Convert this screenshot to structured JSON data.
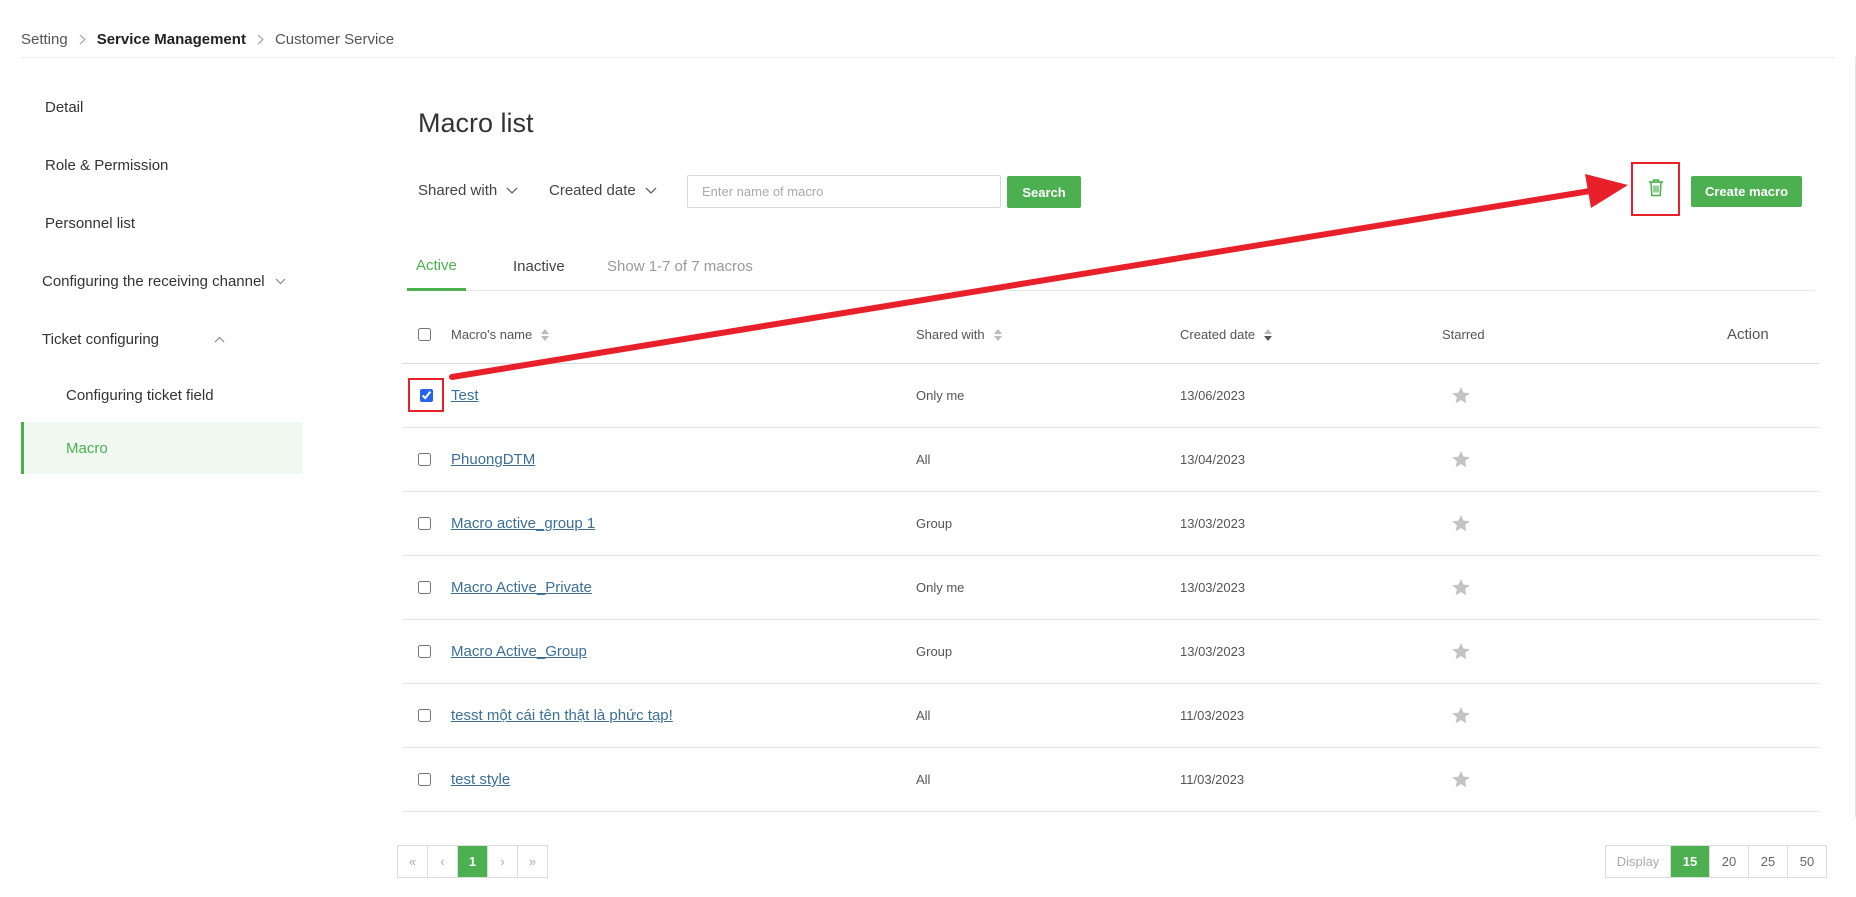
{
  "breadcrumb": {
    "items": [
      "Setting",
      "Service Management",
      "Customer Service"
    ]
  },
  "sidebar": {
    "items": [
      {
        "label": "Detail"
      },
      {
        "label": "Role & Permission"
      },
      {
        "label": "Personnel list"
      },
      {
        "label": "Configuring the receiving channel"
      },
      {
        "label": "Ticket configuring"
      },
      {
        "label": "Configuring ticket field"
      },
      {
        "label": "Macro"
      }
    ]
  },
  "main": {
    "title": "Macro list",
    "filters": {
      "shared_with": "Shared with",
      "created_date": "Created date"
    },
    "search": {
      "placeholder": "Enter name of macro",
      "value": "",
      "button_label": "Search"
    },
    "create_label": "Create macro",
    "delete_icon": "trash-icon",
    "tabs": [
      {
        "label": "Active"
      },
      {
        "label": "Inactive"
      }
    ],
    "tab_info": "Show 1-7 of 7 macros"
  },
  "table": {
    "columns": [
      "Macro's name",
      "Shared with",
      "Created date",
      "Starred",
      "Action"
    ],
    "rows": [
      {
        "name": "Test",
        "shared": "Only me",
        "date": "13/06/2023",
        "checked": true
      },
      {
        "name": "PhuongDTM",
        "shared": "All",
        "date": "13/04/2023",
        "checked": false
      },
      {
        "name": "Macro active_group 1",
        "shared": "Group",
        "date": "13/03/2023",
        "checked": false
      },
      {
        "name": "Macro Active_Private",
        "shared": "Only me",
        "date": "13/03/2023",
        "checked": false
      },
      {
        "name": "Macro Active_Group",
        "shared": "Group",
        "date": "13/03/2023",
        "checked": false
      },
      {
        "name": "tesst một cái tên thật là phức tạp!",
        "shared": "All",
        "date": "11/03/2023",
        "checked": false
      },
      {
        "name": "test style",
        "shared": "All",
        "date": "11/03/2023",
        "checked": false
      }
    ]
  },
  "pagination": {
    "first": "«",
    "prev": "‹",
    "current": "1",
    "next": "›",
    "last": "»"
  },
  "display": {
    "label": "Display",
    "options": [
      "15",
      "20",
      "25",
      "50"
    ],
    "selected": "15"
  },
  "colors": {
    "accent": "#4caf50",
    "annotation": "#e8202a",
    "link": "#3d6f96"
  }
}
